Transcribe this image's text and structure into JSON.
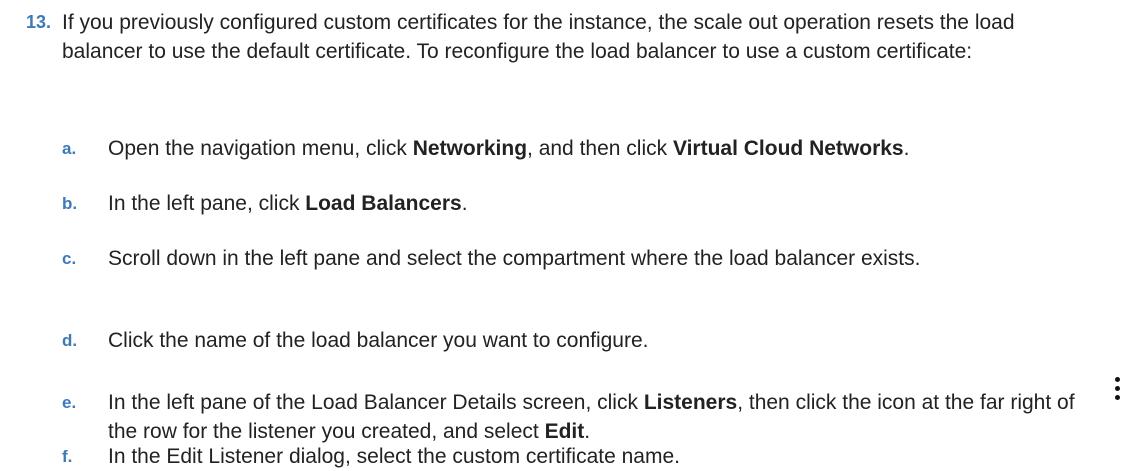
{
  "step13": {
    "number": "13.",
    "text": "If you previously configured custom certificates for the instance, the scale out operation resets the load balancer to use the default certificate. To reconfigure the load balancer to use a custom certificate:"
  },
  "substeps": [
    {
      "letter": "a.",
      "parts": [
        "Open the navigation menu, click ",
        "Networking",
        ", and then click ",
        "Virtual Cloud Networks",
        "."
      ]
    },
    {
      "letter": "b.",
      "parts": [
        "In the left pane, click ",
        "Load Balancers",
        "."
      ]
    },
    {
      "letter": "c.",
      "parts": [
        "Scroll down in the left pane and select the compartment where the load balancer exists."
      ]
    },
    {
      "letter": "d.",
      "parts": [
        "Click the name of the load balancer you want to configure."
      ]
    },
    {
      "letter": "e.",
      "parts": [
        "In the left pane of the Load Balancer Details screen, click ",
        "Listeners",
        ", then click the icon at the far right of the row for the listener you created, and select ",
        "Edit",
        "."
      ]
    },
    {
      "letter": "f.",
      "parts": [
        "In the Edit Listener dialog, select the custom certificate name."
      ]
    }
  ],
  "icons": {
    "row_actions": "kebab-menu-icon"
  }
}
